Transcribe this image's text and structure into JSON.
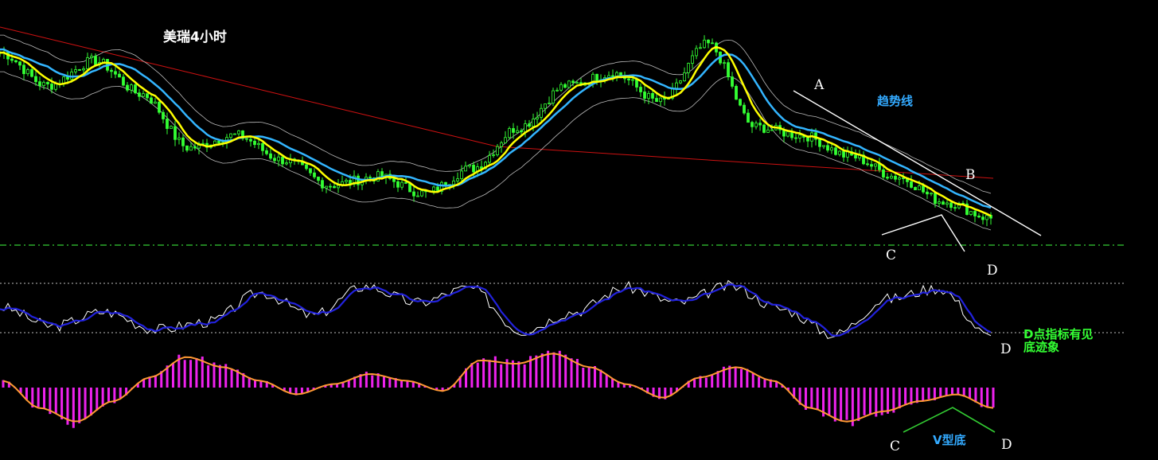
{
  "chart_data": [
    {
      "type": "candlestick",
      "title": "美瑞4小时",
      "annotations": {
        "trendline_label": "趋势线",
        "point_a": "A",
        "point_b": "B",
        "point_c": "C",
        "point_d": "D"
      },
      "support_line": "dashed horizontal at recent low",
      "moving_averages": [
        {
          "color": "#ffff00",
          "role": "short MA"
        },
        {
          "color": "#33b5ff",
          "role": "mid MA"
        },
        {
          "color": "#cc1111",
          "role": "long MA"
        },
        {
          "color": "#bbbbbb",
          "role": "upper/lower band"
        }
      ],
      "candle_color": "#33ff33",
      "price_profile": [
        80,
        72,
        78,
        70,
        57,
        60,
        54,
        48,
        50,
        46,
        52,
        62,
        72,
        75,
        68,
        82,
        62,
        60,
        55,
        50,
        44,
        40
      ]
    },
    {
      "type": "line",
      "indicator": "oscillator (K/D)",
      "annotation_point": "D",
      "note": "D点指标有见底迹象",
      "series_colors": {
        "fast": "#ffffff",
        "slow": "#2222dd"
      },
      "levels": [
        "upper dotted",
        "lower dotted"
      ],
      "d_profile": [
        55,
        25,
        48,
        20,
        32,
        78,
        42,
        88,
        62,
        85,
        18,
        48,
        86,
        62,
        88,
        52,
        12,
        68,
        85,
        8
      ]
    },
    {
      "type": "bar",
      "indicator": "MACD histogram",
      "bar_color": "#ee22ee",
      "signal_color": "#ff9933",
      "pattern_label": "V型底",
      "point_c": "C",
      "point_d": "D",
      "pattern_color": "#33cc33",
      "hist_profile": [
        0.2,
        -0.6,
        -1.0,
        -0.4,
        0.3,
        0.9,
        0.6,
        0.2,
        -0.2,
        0.1,
        0.4,
        0.2,
        -0.1,
        0.8,
        0.7,
        1.0,
        0.6,
        0.1,
        -0.3,
        0.3,
        0.6,
        0.2,
        -0.6,
        -1.0,
        -0.7,
        -0.4,
        -0.2,
        -0.6
      ]
    }
  ]
}
